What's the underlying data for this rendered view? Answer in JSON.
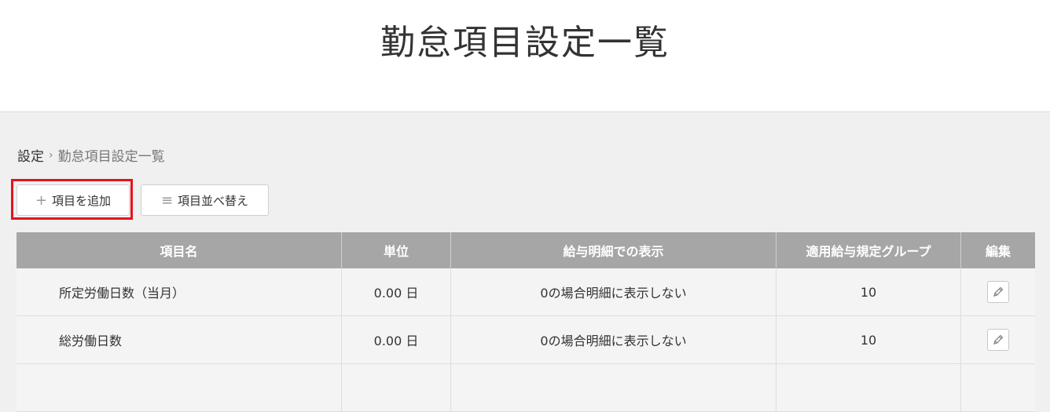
{
  "header": {
    "title": "勤怠項目設定一覧"
  },
  "breadcrumb": {
    "root": "設定",
    "separator": "›",
    "current": "勤怠項目設定一覧"
  },
  "toolbar": {
    "add_icon": "plus-icon",
    "add_label": "項目を追加",
    "sort_icon": "list-icon",
    "sort_label": "項目並べ替え"
  },
  "table": {
    "headers": [
      "項目名",
      "単位",
      "給与明細での表示",
      "適用給与規定グループ",
      "編集"
    ],
    "rows": [
      {
        "name": "所定労働日数（当月）",
        "unit": "0.00 日",
        "display": "0の場合明細に表示しない",
        "group": "10",
        "edit_icon": "pencil-icon"
      },
      {
        "name": "総労働日数",
        "unit": "0.00 日",
        "display": "0の場合明細に表示しない",
        "group": "10",
        "edit_icon": "pencil-icon"
      }
    ]
  },
  "colors": {
    "highlight": "#e3141f",
    "table_header": "#a6a6a6"
  }
}
